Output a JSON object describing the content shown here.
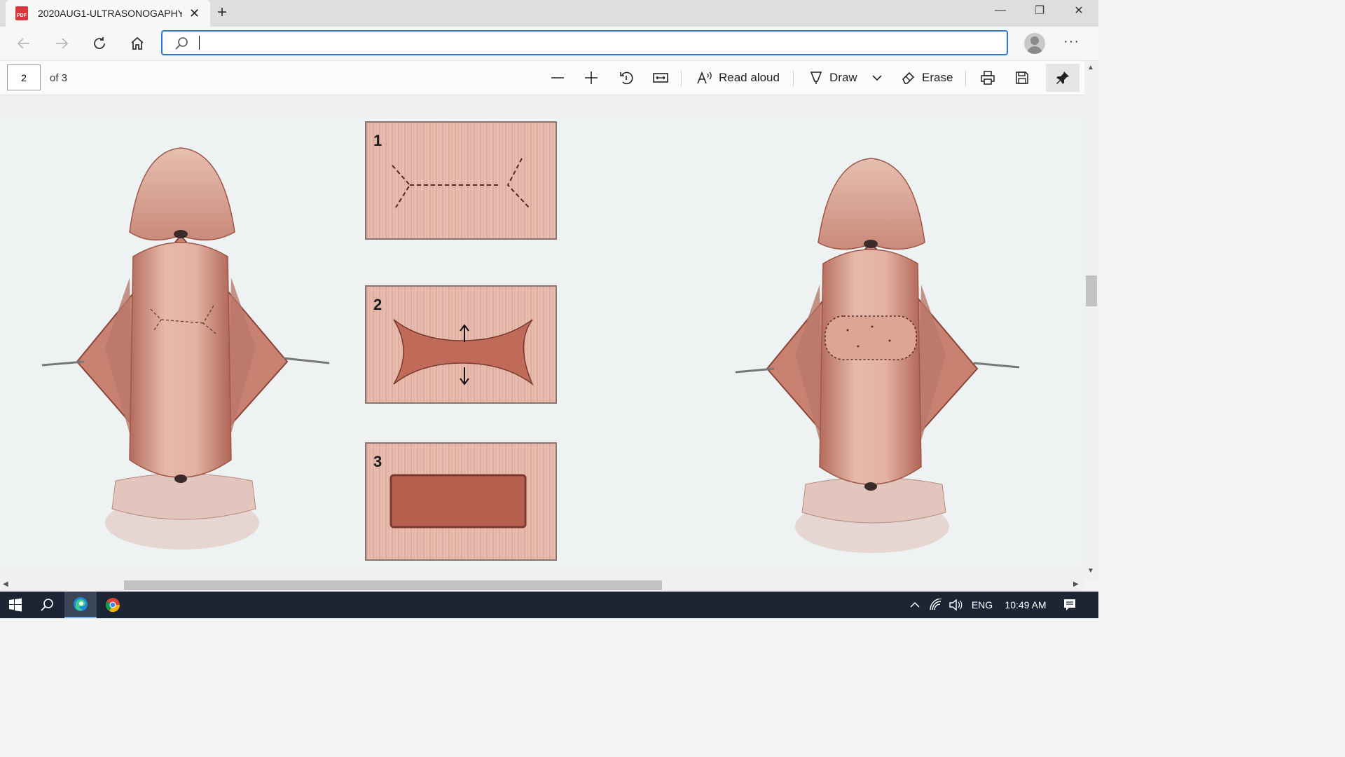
{
  "tab": {
    "title": "2020AUG1-ULTRASONOGAPHY-",
    "pdf_icon_text": "PDF"
  },
  "window": {
    "minimize_glyph": "—",
    "restore_glyph": "❐",
    "close_glyph": "✕"
  },
  "navbar": {
    "address_value": "",
    "more_glyph": "···"
  },
  "pdf_toolbar": {
    "page_value": "2",
    "page_total": "of 3",
    "read_aloud_label": "Read aloud",
    "draw_label": "Draw",
    "erase_label": "Erase"
  },
  "document": {
    "panels": [
      {
        "number": "1"
      },
      {
        "number": "2"
      },
      {
        "number": "3"
      }
    ]
  },
  "taskbar": {
    "language": "ENG",
    "time": "10:49 AM"
  },
  "colors": {
    "accent": "#2a7ad6",
    "tissue": "#d9a090",
    "tissue_dark": "#a85a4a",
    "taskbar": "#1c2534"
  }
}
